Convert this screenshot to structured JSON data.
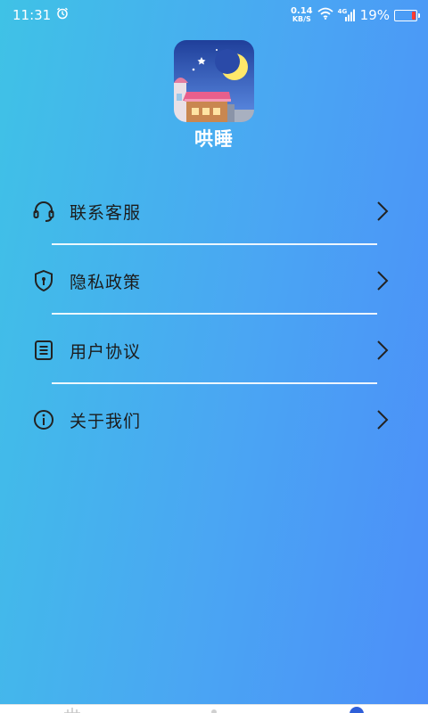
{
  "status_bar": {
    "time": "11:31",
    "net_speed_value": "0.14",
    "net_speed_unit": "KB/S",
    "network_type": "4G",
    "battery_percent": "19%",
    "battery_level": 0.19,
    "battery_color": "#ff3b30"
  },
  "app": {
    "name": "哄睡"
  },
  "menu": {
    "items": [
      {
        "label": "联系客服",
        "icon": "headset-icon"
      },
      {
        "label": "隐私政策",
        "icon": "shield-icon"
      },
      {
        "label": "用户协议",
        "icon": "document-icon"
      },
      {
        "label": "关于我们",
        "icon": "info-icon"
      }
    ]
  },
  "colors": {
    "gradient_start": "#3fc2e6",
    "gradient_end": "#4c8ef9",
    "text": "#1c1c1c",
    "divider": "#ffffff"
  }
}
